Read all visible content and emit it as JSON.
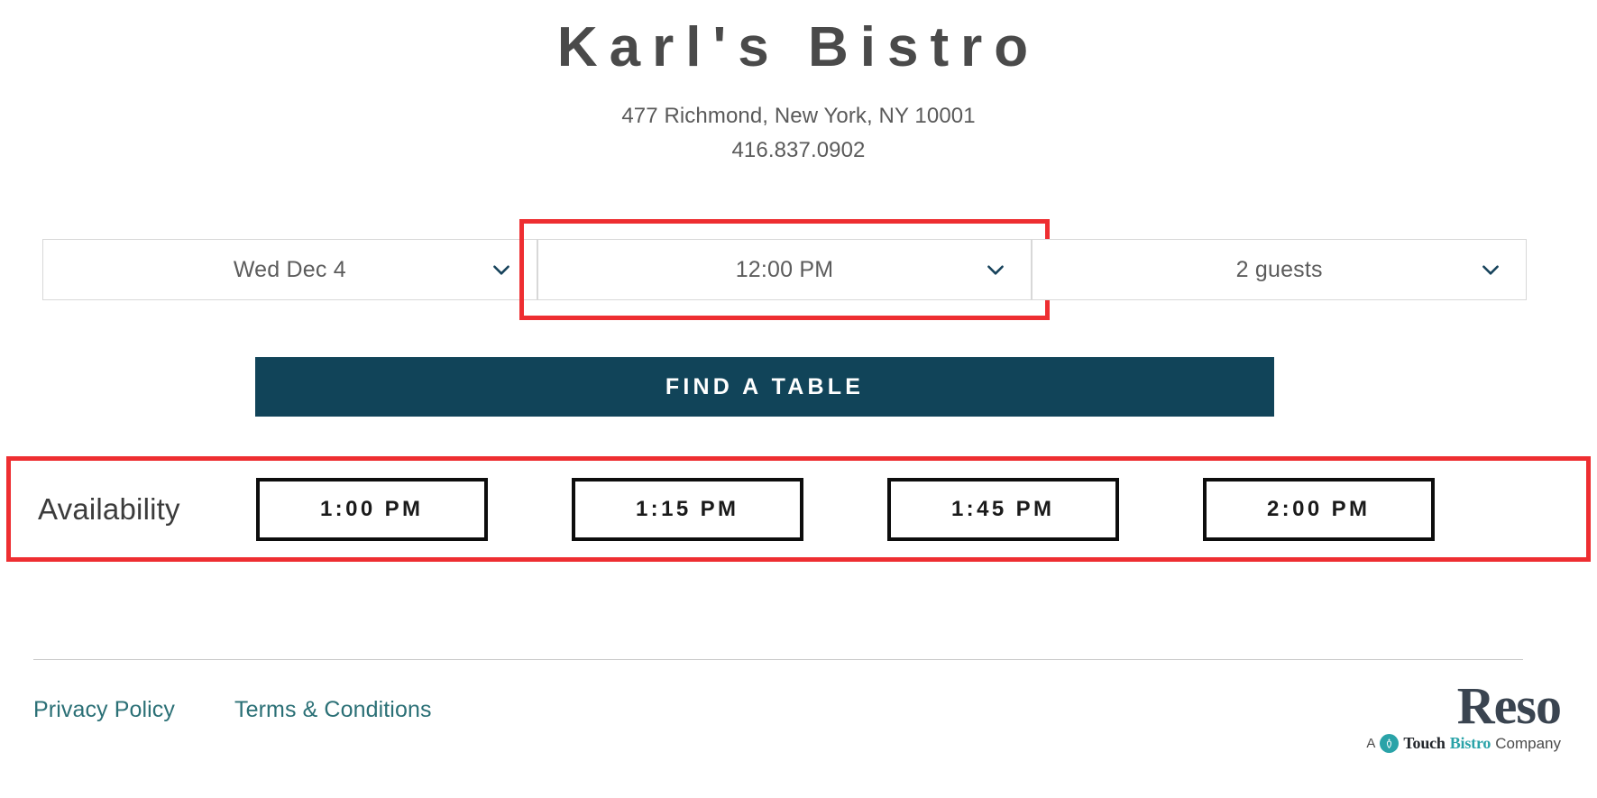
{
  "restaurant": {
    "name": "Karl's Bistro",
    "address": "477 Richmond, New York, NY 10001",
    "phone": "416.837.0902"
  },
  "search": {
    "date": {
      "label": "Wed Dec 4",
      "icon": "chevron-down-icon"
    },
    "time": {
      "label": "12:00 PM",
      "icon": "chevron-down-icon",
      "highlighted": true
    },
    "party_size": {
      "label": "2 guests",
      "icon": "chevron-down-icon"
    },
    "submit_label": "FIND A TABLE"
  },
  "availability": {
    "label": "Availability",
    "slots": [
      {
        "label": "1:00 PM"
      },
      {
        "label": "1:15 PM"
      },
      {
        "label": "1:45 PM"
      },
      {
        "label": "2:00 PM"
      }
    ]
  },
  "footer": {
    "links": [
      {
        "label": "Privacy Policy"
      },
      {
        "label": "Terms & Conditions"
      }
    ],
    "logo": {
      "wordmark": "Reso",
      "tagline_a": "A",
      "tagline_touch": "Touch",
      "tagline_bistro": "Bistro",
      "tagline_company": "Company",
      "badge_icon": "pineapple-icon"
    }
  },
  "colors": {
    "brand_dark_teal": "#114459",
    "link_teal": "#2b7076",
    "highlight_red": "#ee2e31",
    "slot_border": "#0d0d0d",
    "logo_teal": "#2aa3a8"
  }
}
